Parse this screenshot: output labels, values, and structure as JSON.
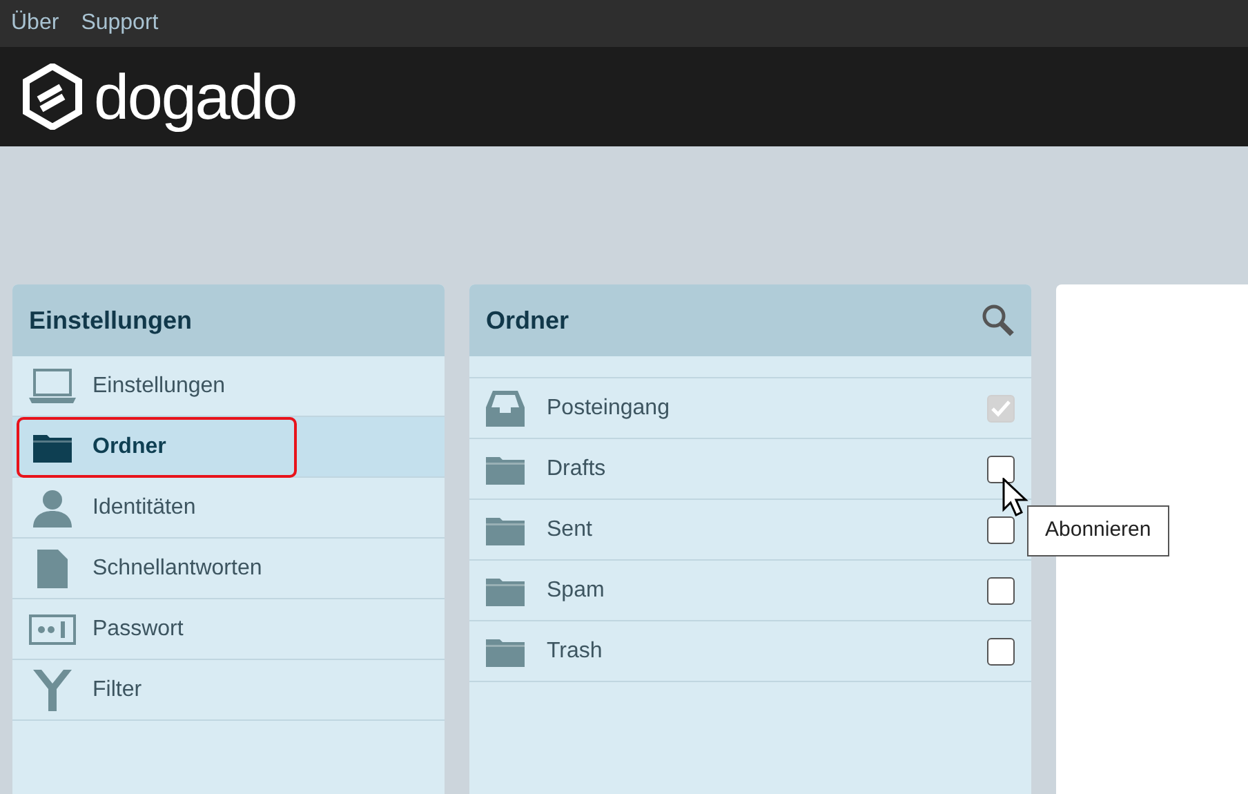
{
  "top_menu": [
    "Über",
    "Support"
  ],
  "logo": {
    "text": "dogado"
  },
  "settings_panel": {
    "title": "Einstellungen",
    "items": [
      {
        "label": "Einstellungen",
        "kind": "laptop",
        "selected": false,
        "highlighted": false
      },
      {
        "label": "Ordner",
        "kind": "folder",
        "selected": true,
        "highlighted": true
      },
      {
        "label": "Identitäten",
        "kind": "person",
        "selected": false,
        "highlighted": false
      },
      {
        "label": "Schnellantworten",
        "kind": "document",
        "selected": false,
        "highlighted": false
      },
      {
        "label": "Passwort",
        "kind": "password",
        "selected": false,
        "highlighted": false
      },
      {
        "label": "Filter",
        "kind": "filter",
        "selected": false,
        "highlighted": false
      }
    ]
  },
  "folders_panel": {
    "title": "Ordner",
    "folders": [
      {
        "name": "Posteingang",
        "kind": "inbox",
        "subscribed": true,
        "disabled": true,
        "hovered": false
      },
      {
        "name": "Drafts",
        "kind": "folder",
        "subscribed": false,
        "disabled": false,
        "hovered": true
      },
      {
        "name": "Sent",
        "kind": "folder",
        "subscribed": false,
        "disabled": false,
        "hovered": false
      },
      {
        "name": "Spam",
        "kind": "folder",
        "subscribed": false,
        "disabled": false,
        "hovered": false
      },
      {
        "name": "Trash",
        "kind": "folder",
        "subscribed": false,
        "disabled": false,
        "hovered": false
      }
    ]
  },
  "tooltip": "Abonnieren"
}
